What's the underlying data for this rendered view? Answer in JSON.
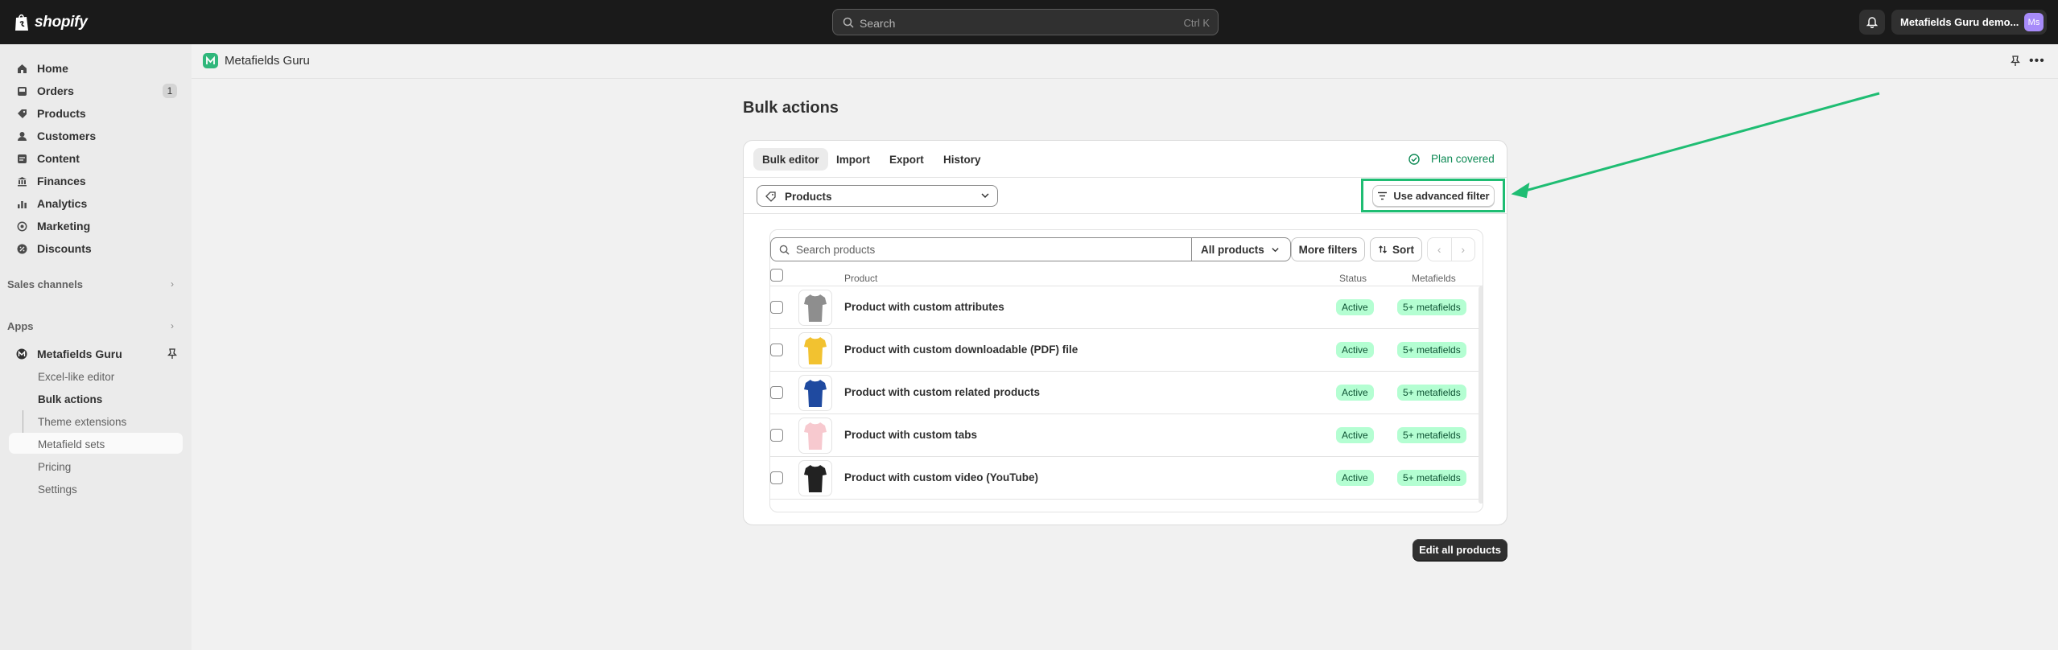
{
  "topbar": {
    "brand": "shopify",
    "search_placeholder": "Search",
    "search_shortcut": "Ctrl K",
    "store_name": "Metafields Guru demo...",
    "avatar_initials": "Ms"
  },
  "sidebar": {
    "items": [
      {
        "label": "Home",
        "icon": "home-icon"
      },
      {
        "label": "Orders",
        "icon": "inbox-icon",
        "badge": "1"
      },
      {
        "label": "Products",
        "icon": "tag-icon"
      },
      {
        "label": "Customers",
        "icon": "person-icon"
      },
      {
        "label": "Content",
        "icon": "content-icon"
      },
      {
        "label": "Finances",
        "icon": "bank-icon"
      },
      {
        "label": "Analytics",
        "icon": "chart-icon"
      },
      {
        "label": "Marketing",
        "icon": "target-icon"
      },
      {
        "label": "Discounts",
        "icon": "discount-icon"
      }
    ],
    "sales_channels": "Sales channels",
    "apps": "Apps",
    "app_name": "Metafields Guru",
    "app_sub_items": [
      "Excel-like editor",
      "Bulk actions",
      "Theme extensions",
      "Metafield sets",
      "Pricing",
      "Settings"
    ]
  },
  "appbar": {
    "title": "Metafields Guru"
  },
  "page": {
    "title": "Bulk actions",
    "tabs": [
      "Bulk editor",
      "Import",
      "Export",
      "History"
    ],
    "plan_label": "Plan covered",
    "resource_select": "Products",
    "advanced_filter": "Use advanced filter",
    "search_placeholder": "Search products",
    "all_products": "All products",
    "more_filters": "More filters",
    "sort": "Sort",
    "columns": {
      "product": "Product",
      "status": "Status",
      "metafields": "Metafields"
    },
    "rows": [
      {
        "name": "Product with custom attributes",
        "status": "Active",
        "metafields": "5+ metafields",
        "color": "#8e8e8e"
      },
      {
        "name": "Product with custom downloadable (PDF) file",
        "status": "Active",
        "metafields": "5+ metafields",
        "color": "#f2c230"
      },
      {
        "name": "Product with custom related products",
        "status": "Active",
        "metafields": "5+ metafields",
        "color": "#1f4aa0"
      },
      {
        "name": "Product with custom tabs",
        "status": "Active",
        "metafields": "5+ metafields",
        "color": "#f7c9cf"
      },
      {
        "name": "Product with custom video (YouTube)",
        "status": "Active",
        "metafields": "5+ metafields",
        "color": "#222222"
      }
    ],
    "edit_all": "Edit all products"
  },
  "colors": {
    "highlight": "#1fbd73",
    "status_bg": "#b4fed2",
    "topbar": "#1a1a1a"
  }
}
